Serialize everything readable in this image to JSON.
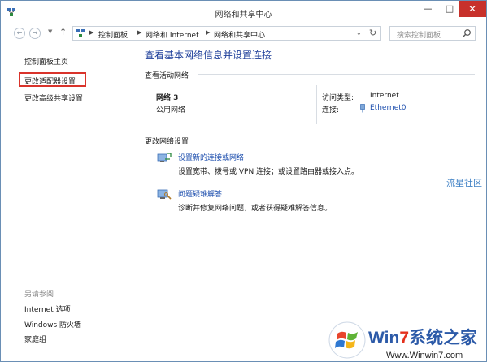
{
  "window": {
    "title": "网络和共享中心"
  },
  "titlebar": {
    "minimize": "—",
    "maximize": "□",
    "close": "✕"
  },
  "address": {
    "crumbs": [
      "控制面板",
      "网络和 Internet",
      "网络和共享中心"
    ],
    "search_placeholder": "搜索控制面板"
  },
  "sidebar": {
    "home": "控制面板主页",
    "items": [
      "更改适配器设置",
      "更改高级共享设置"
    ],
    "see_also_title": "另请参阅",
    "see_also": [
      "Internet 选项",
      "Windows 防火墙",
      "家庭组"
    ]
  },
  "main": {
    "title": "查看基本网络信息并设置连接",
    "active_header": "查看活动网络",
    "network_name": "网络  3",
    "network_type": "公用网络",
    "access_label": "访问类型:",
    "access_value": "Internet",
    "conn_label": "连接:",
    "conn_value": "Ethernet0",
    "change_header": "更改网络设置",
    "tasks": [
      {
        "link": "设置新的连接或网络",
        "desc": "设置宽带、拨号或 VPN 连接；或设置路由器或接入点。"
      },
      {
        "link": "问题疑难解答",
        "desc": "诊断并修复网络问题，或者获得疑难解答信息。"
      }
    ]
  },
  "watermark": {
    "side": "流星社区",
    "logo_brand": "Win7系统之家",
    "logo_url": "Www.Winwin7.com"
  },
  "colors": {
    "link": "#1e4fae",
    "title": "#1e3f9a",
    "highlight": "#d9332b",
    "close": "#c7312b"
  }
}
